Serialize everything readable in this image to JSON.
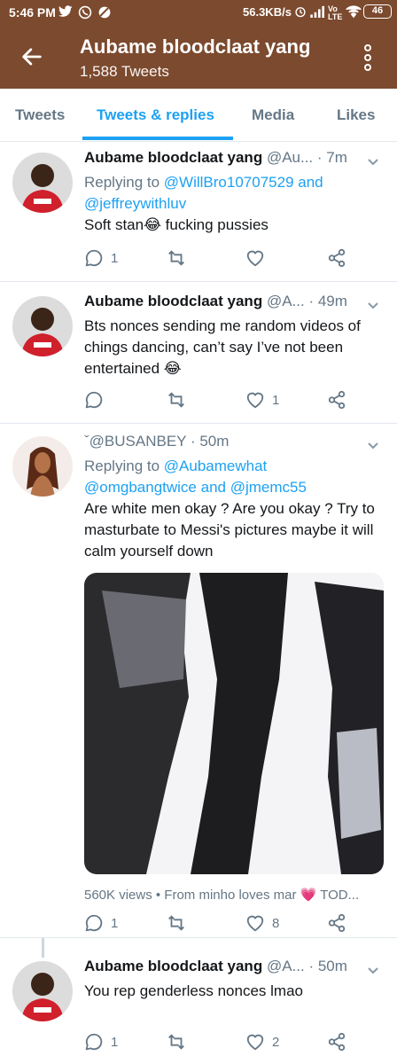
{
  "status_bar": {
    "time": "5:46 PM",
    "speed": "56.3KB/s",
    "battery": "46"
  },
  "header": {
    "title": "Aubame bloodclaat yang",
    "subtitle": "1,588 Tweets"
  },
  "tabs": [
    {
      "label": "Tweets"
    },
    {
      "label": "Tweets & replies",
      "active": true
    },
    {
      "label": "Media"
    },
    {
      "label": "Likes"
    }
  ],
  "tweets": [
    {
      "name": "Aubame bloodclaat yang",
      "handle": "@Au...",
      "time": "· 7m",
      "replying_prefix": "Replying to",
      "replying_1": "@WillBro10707529",
      "replying_and": "and",
      "replying_2": "@jeffreywithluv",
      "text": "Soft stan😂 fucking pussies",
      "reply_count": "1",
      "retweet_count": "",
      "like_count": ""
    },
    {
      "name": "Aubame bloodclaat yang",
      "handle": "@A...",
      "time": "· 49m",
      "text": "Bts nonces sending me random videos of chings dancing, can’t say I’ve not been entertained 😂",
      "reply_count": "",
      "retweet_count": "",
      "like_count": "1"
    },
    {
      "name": "ˇ@BUSANBEY",
      "time": "· 50m",
      "replying_prefix": "Replying to",
      "replying_1": "@Aubamewhat",
      "replying_2": "@omgbangtwice",
      "replying_and": "and",
      "replying_3": "@jmemc55",
      "text": "Are white men okay ? Are you okay ? Try to masturbate to Messi's pictures maybe it will calm yourself down",
      "views": "560K views • From minho loves mar 💗 TOD...",
      "reply_count": "1",
      "retweet_count": "",
      "like_count": "8"
    },
    {
      "name": "Aubame bloodclaat yang",
      "handle": "@A...",
      "time": "· 50m",
      "text": "You rep genderless nonces lmao",
      "reply_count": "1",
      "retweet_count": "",
      "like_count": "2"
    }
  ],
  "colors": {
    "header_bg": "#7c4a2e",
    "accent": "#1da1f2",
    "muted": "#657786"
  }
}
